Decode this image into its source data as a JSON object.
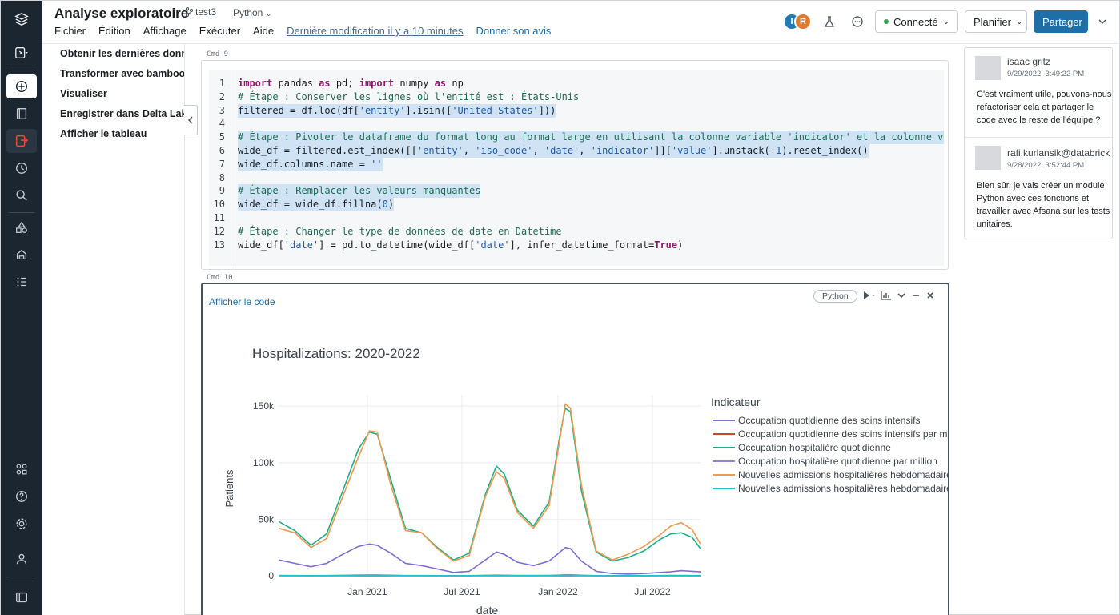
{
  "header": {
    "title": "Analyse exploratoire",
    "branch": "test3",
    "language": "Python",
    "menu": [
      "Fichier",
      "Édition",
      "Affichage",
      "Exécuter",
      "Aide"
    ],
    "last_modified": "Dernière modification il y a 10 minutes",
    "feedback": "Donner son avis",
    "avatars": [
      {
        "initial": "I",
        "color": "#1f7ab8"
      },
      {
        "initial": "R",
        "color": "#e07a2e"
      }
    ],
    "connected_label": "Connecté",
    "schedule_label": "Planifier",
    "share_label": "Partager"
  },
  "outline": {
    "items": [
      "Obtenir les dernières données",
      "Transformer avec bamboolib",
      "Visualiser",
      "Enregistrer dans Delta Lake",
      "Afficher le tableau"
    ]
  },
  "code_cell": {
    "label": "Cmd 9",
    "lines": [
      {
        "n": "1",
        "text": "import pandas as pd; import numpy as np"
      },
      {
        "n": "2",
        "text": "# Étape : Conserver les lignes où l'entité est : États-Unis"
      },
      {
        "n": "3",
        "text": "filtered = df.loc(df['entity'].isin(['United States']))"
      },
      {
        "n": "4",
        "text": ""
      },
      {
        "n": "5",
        "text": "# Étape : Pivoter le dataframe du format long au format large en utilisant la colonne variable 'indicator' et la colonne valeur 'value'"
      },
      {
        "n": "6",
        "text": "wide_df = filtered.est_index([['entity', 'iso_code', 'date', 'indicator']]['value'].unstack(-1).reset_index()"
      },
      {
        "n": "7",
        "text": "wide_df.columns.name = ''"
      },
      {
        "n": "8",
        "text": ""
      },
      {
        "n": "9",
        "text": "# Étape : Remplacer les valeurs manquantes"
      },
      {
        "n": "10",
        "text": "wide_df = wide_df.fillna(0)"
      },
      {
        "n": "11",
        "text": ""
      },
      {
        "n": "12",
        "text": "# Étape : Changer le type de données de date en Datetime"
      },
      {
        "n": "13",
        "text": "wide_df['date'] = pd.to_datetime(wide_df['date'], infer_datetime_format=True)"
      }
    ]
  },
  "output_cell": {
    "label": "Cmd 10",
    "show_code": "Afficher le code",
    "language": "Python"
  },
  "comments": [
    {
      "author": "isaac gritz",
      "time": "9/29/2022, 3:49:22 PM",
      "body": "C'est vraiment utile, pouvons-nous refactoriser cela et partager le code avec le reste de l'équipe ?"
    },
    {
      "author": "rafi.kurlansik@databricks.com",
      "time": "9/28/2022, 3:52:44 PM",
      "body": "Bien sûr, je vais créer un module Python avec ces fonctions et travailler avec Afsana sur les tests unitaires."
    }
  ],
  "chart_data": {
    "type": "line",
    "title": "Hospitalizations: 2020-2022",
    "xlabel": "date",
    "ylabel": "Patients",
    "legend_title": "Indicateur",
    "legend_position": "right",
    "x_ticks": [
      "Jan 2021",
      "Jul 2021",
      "Jan 2022",
      "Jul 2022"
    ],
    "y_ticks": [
      "0",
      "50k",
      "100k",
      "150k"
    ],
    "ylim": [
      0,
      160000
    ],
    "xlim": [
      "2020-07-15",
      "2022-10-01"
    ],
    "grid": true,
    "x": [
      "2020-07-15",
      "2020-08-15",
      "2020-09-15",
      "2020-10-15",
      "2020-11-15",
      "2020-12-15",
      "2021-01-05",
      "2021-01-20",
      "2021-02-15",
      "2021-03-15",
      "2021-04-15",
      "2021-05-15",
      "2021-06-15",
      "2021-07-15",
      "2021-08-15",
      "2021-09-05",
      "2021-09-20",
      "2021-10-15",
      "2021-11-15",
      "2021-12-15",
      "2022-01-05",
      "2022-01-15",
      "2022-01-25",
      "2022-02-15",
      "2022-03-15",
      "2022-04-15",
      "2022-05-15",
      "2022-06-15",
      "2022-07-15",
      "2022-08-05",
      "2022-08-25",
      "2022-09-15",
      "2022-10-01"
    ],
    "series": [
      {
        "name": "Occupation quotidienne des soins intensifs",
        "color": "#7b6fd0",
        "values": [
          14000,
          11000,
          8000,
          11000,
          19000,
          26000,
          28000,
          27000,
          20000,
          11000,
          9000,
          6000,
          3000,
          4000,
          14000,
          21000,
          19000,
          12000,
          9000,
          13000,
          21000,
          25000,
          24000,
          13000,
          4000,
          2000,
          1500,
          2000,
          3000,
          3500,
          4500,
          4000,
          3500
        ]
      },
      {
        "name": "Occupation quotidienne des soins intensifs par million",
        "color": "#c4462a",
        "values": [
          50,
          40,
          30,
          40,
          60,
          80,
          90,
          85,
          60,
          35,
          30,
          20,
          10,
          12,
          45,
          65,
          60,
          40,
          30,
          40,
          65,
          75,
          70,
          40,
          12,
          6,
          5,
          6,
          9,
          11,
          14,
          12,
          10
        ]
      },
      {
        "name": "Occupation hospitalière quotidienne",
        "color": "#1fb089",
        "values": [
          48000,
          40000,
          27000,
          37000,
          75000,
          112000,
          127000,
          125000,
          85000,
          42000,
          38000,
          25000,
          14000,
          20000,
          72000,
          97000,
          90000,
          58000,
          44000,
          65000,
          125000,
          148000,
          145000,
          75000,
          21000,
          13000,
          16000,
          22000,
          32000,
          37000,
          38000,
          34000,
          24000
        ]
      },
      {
        "name": "Occupation hospitalière quotidienne par million",
        "color": "#8c87d6",
        "values": [
          140,
          120,
          80,
          110,
          225,
          335,
          380,
          375,
          255,
          125,
          115,
          75,
          42,
          60,
          215,
          290,
          270,
          175,
          132,
          195,
          375,
          445,
          435,
          225,
          63,
          39,
          48,
          66,
          96,
          111,
          114,
          102,
          72
        ]
      },
      {
        "name": "Nouvelles admissions hospitalières hebdomadaires",
        "color": "#ef9a52",
        "values": [
          42000,
          38000,
          25000,
          33000,
          70000,
          105000,
          128000,
          127000,
          80000,
          40000,
          38000,
          24000,
          13000,
          18000,
          70000,
          92000,
          86000,
          56000,
          42000,
          62000,
          122000,
          152000,
          148000,
          80000,
          22000,
          14000,
          19000,
          26000,
          36000,
          44000,
          47000,
          41000,
          28000
        ]
      },
      {
        "name": "Nouvelles admissions hospitalières hebdomadaires par million",
        "color": "#22c3c8",
        "values": [
          250,
          230,
          150,
          200,
          420,
          630,
          770,
          760,
          480,
          240,
          230,
          145,
          78,
          110,
          420,
          550,
          515,
          335,
          250,
          370,
          730,
          910,
          890,
          480,
          130,
          85,
          115,
          155,
          215,
          265,
          280,
          245,
          170
        ]
      }
    ]
  }
}
